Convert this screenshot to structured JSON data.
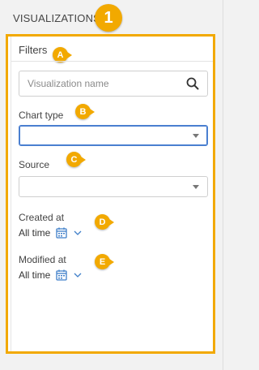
{
  "header": {
    "title": "VISUALIZATIONS",
    "step_badge": "1"
  },
  "panel": {
    "title": "Filters",
    "title_badge": "A",
    "search": {
      "placeholder": "Visualization name",
      "value": "",
      "icon": "search-icon"
    },
    "chart_type": {
      "label": "Chart type",
      "badge": "B",
      "value": ""
    },
    "source": {
      "label": "Source",
      "badge": "C",
      "value": ""
    },
    "created_at": {
      "label": "Created at",
      "badge": "D",
      "value": "All time"
    },
    "modified_at": {
      "label": "Modified at",
      "badge": "E",
      "value": "All time"
    }
  },
  "colors": {
    "accent": "#f2a900",
    "focus": "#4a7fd0",
    "icon_blue": "#3f7fc9"
  }
}
